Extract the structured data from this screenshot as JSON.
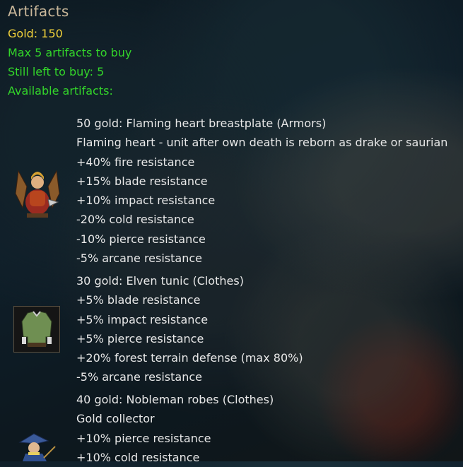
{
  "header": {
    "title": "Artifacts",
    "gold": "Gold: 150",
    "max_buy": "Max 5 artifacts to buy",
    "left_to_buy": "Still left to buy: 5",
    "available": "Available artifacts:"
  },
  "artifacts": [
    {
      "icon": "winged-warrior-portrait",
      "lines": [
        "50 gold: Flaming heart breastplate (Armors)",
        "Flaming heart - unit after own death is reborn as drake or saurian",
        "+40% fire resistance",
        "+15% blade resistance",
        "+10% impact resistance",
        "-20% cold resistance",
        "-10% pierce resistance",
        "-5% arcane resistance"
      ]
    },
    {
      "icon": "green-tunic",
      "lines": [
        "30 gold: Elven tunic (Clothes)",
        "+5% blade resistance",
        "+5% impact resistance",
        "+5% pierce resistance",
        "+20% forest terrain defense (max 80%)",
        "-5% arcane resistance"
      ]
    },
    {
      "icon": "nobleman-portrait",
      "lines": [
        "40 gold: Nobleman robes (Clothes)",
        "Gold collector",
        "+10% pierce resistance",
        "+10% cold resistance"
      ]
    }
  ],
  "colors": {
    "title": "#c9b79a",
    "gold": "#f2d23a",
    "green": "#33d62a",
    "text": "#e8e8e8"
  }
}
